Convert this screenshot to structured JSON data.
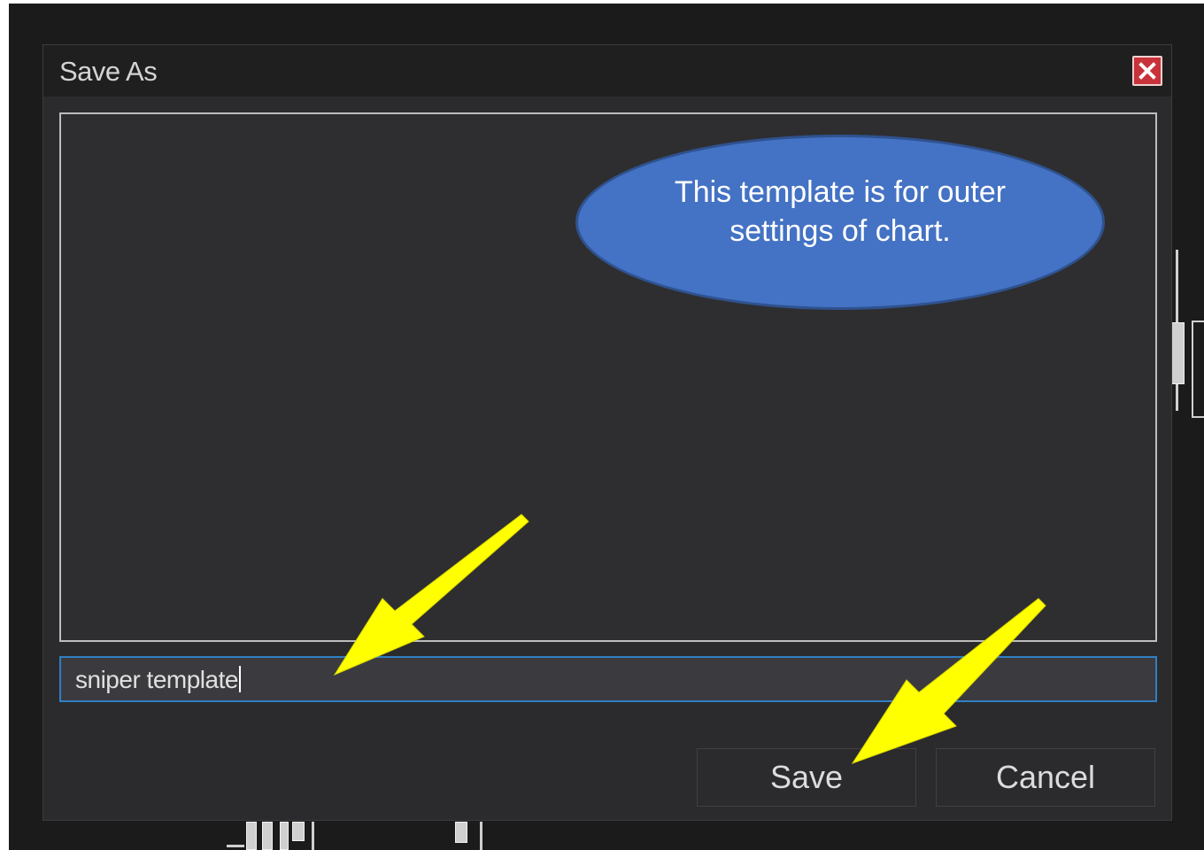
{
  "dialog": {
    "title": "Save As",
    "close_icon": "close-icon",
    "filename_value": "sniper template",
    "save_label": "Save",
    "cancel_label": "Cancel"
  },
  "annotation": {
    "callout_text": "This template is for outer settings of chart.",
    "arrow_color": "#ffff00"
  },
  "colors": {
    "accent": "#2f7fc4",
    "callout_fill": "#4472c4",
    "close_button": "#c8323a"
  }
}
